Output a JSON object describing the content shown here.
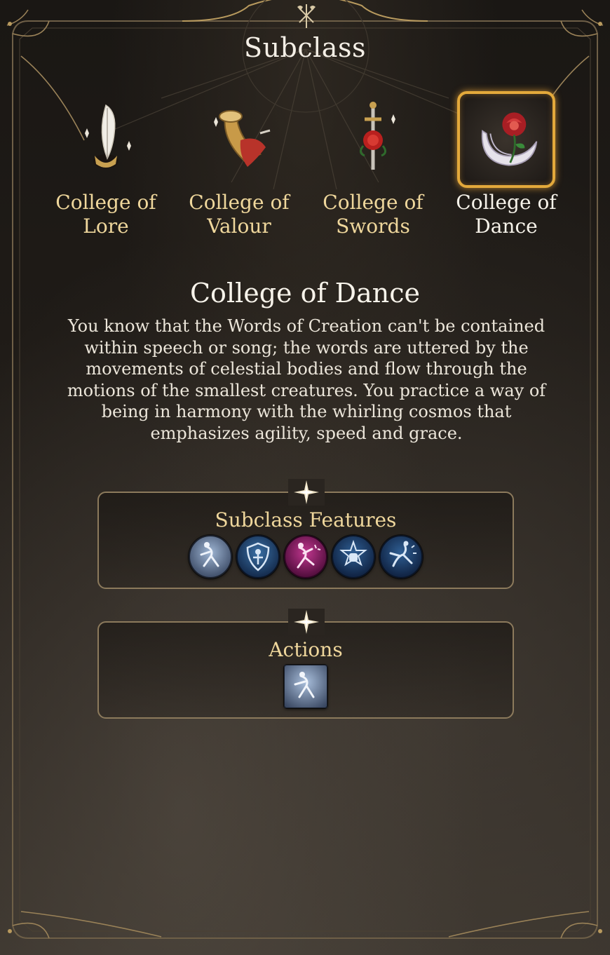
{
  "header": {
    "title": "Subclass",
    "emblem_icon": "crossed-axes-emblem-icon"
  },
  "subclasses": [
    {
      "line1": "College of",
      "line2": "Lore",
      "icon": "quill-inkwell-icon",
      "selected": false
    },
    {
      "line1": "College of",
      "line2": "Valour",
      "icon": "war-horn-icon",
      "selected": false
    },
    {
      "line1": "College of",
      "line2": "Swords",
      "icon": "dagger-rose-icon",
      "selected": false
    },
    {
      "line1": "College of",
      "line2": "Dance",
      "icon": "rose-crescent-icon",
      "selected": true
    }
  ],
  "details": {
    "title": "College of Dance",
    "description": "You know that the Words of Creation can't be contained within speech or song; the words are uttered by the movements of celestial bodies and flow through the motions of the smallest creatures. You practice a way of being in harmony with the whirling cosmos that emphasizes agility, speed and grace."
  },
  "features": {
    "title": "Subclass Features",
    "icons": [
      "dazzling-footwork-icon",
      "unarmored-defence-icon",
      "agile-performer-icon",
      "martial-arts-fist-icon",
      "dance-leap-icon"
    ]
  },
  "actions": {
    "title": "Actions",
    "icons": [
      "dazzling-footwork-action-icon"
    ]
  },
  "colors": {
    "gold_text": "#efd79c",
    "selected_border": "#e3a93b",
    "white_text": "#f7f3ea",
    "frame_line": "#8c7a5c"
  }
}
